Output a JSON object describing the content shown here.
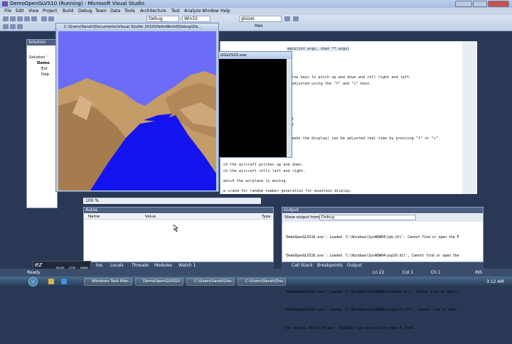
{
  "window": {
    "title": "DemoOpenGLVS10 (Running) - Microsoft Visual Studio"
  },
  "menu": [
    "File",
    "Edit",
    "View",
    "Project",
    "Build",
    "Debug",
    "Team",
    "Data",
    "Tools",
    "Architecture",
    "Test",
    "Analyze",
    "Window",
    "Help"
  ],
  "toolbar": {
    "config": "Debug",
    "platform": "Win32",
    "find": "glsizei",
    "hex": "Hex"
  },
  "solution_explorer": {
    "title": "Solution Explorer",
    "items": [
      "Solution '",
      "Demo",
      "Ext",
      "Dep"
    ]
  },
  "gl_window": {
    "title": "C:\\Users\\Sarah\\Documents\\Visual Studio 2010\\HelloWorld\\Debug\\De..."
  },
  "console_window": {
    "title": "OGLVS10.exe"
  },
  "editor": {
    "signature": "main(int argc, char ** argv)",
    "lines": [
      "row keys to pitch up and down and roll right and left.",
      "adjusted using the \"f\" and \"c\" keys.",
      "y",
      "y",
      "make the display) can be adjusted real-time by pressing \"f\" or \"c\"",
      "ch the aircraft pitches up and down.",
      "ch the aircraft rolls left and right.",
      "which the airplane is moving.",
      "e srand for random number generation for mountain display."
    ],
    "zoom": "100 %"
  },
  "autos": {
    "title": "Autos",
    "col_name": "Name",
    "col_value": "Value",
    "col_type": "Type"
  },
  "output": {
    "title": "Output",
    "show_label": "Show output from:",
    "source": "Debug",
    "lines": [
      "'DemoOpenGLVS10.exe': Loaded 'C:\\Windows\\SysWOW64\\lpk.dll', Cannot find or open the P",
      "'DemoOpenGLVS10.exe': Loaded 'C:\\Windows\\SysWOW64\\usp10.dll', Cannot find or open the",
      "'DemoOpenGLVS10.exe': Loaded 'C:\\Windows\\winsxs\\x86_microsoft.windows.common-controls",
      "'DemoOpenGLVS10.exe': Loaded 'C:\\Windows\\SysWOW64\\uxtheme.dll', Cannot find or open t",
      "'DemoOpenGLVS10.exe': Loaded 'C:\\Windows\\SysWOW64\\nvoglv32.dll', Cannot find or open",
      "The thread 'Win32 Thread' (0x18d4) has exited with code 0 (0x0)."
    ]
  },
  "bottom_tabs_left": [
    "tos",
    "Locals",
    "Threads",
    "Modules",
    "Watch 1"
  ],
  "bottom_tabs_right": [
    "Call Stack",
    "Breakpoints",
    "Output"
  ],
  "status": {
    "ready": "Ready",
    "ln": "Ln 22",
    "col": "Col 1",
    "ch": "Ch 1",
    "ins": "INS"
  },
  "watermark": {
    "brand": "ez",
    "sub": "SCREENCAST",
    "btns": [
      "PAUSE",
      "STOP",
      "DRAW"
    ]
  },
  "taskbar": {
    "items": [
      "Windows Task Man...",
      "DemoOpenGLVS10 ...",
      "C:\\Users\\Sarah\\Doc...",
      "C:\\Users\\Sarah\\Doc..."
    ],
    "time": "3:12 AM"
  },
  "colors": {
    "sky": "#6c6cf8",
    "water": "#1414f0",
    "terrain": "#b08a5a"
  }
}
